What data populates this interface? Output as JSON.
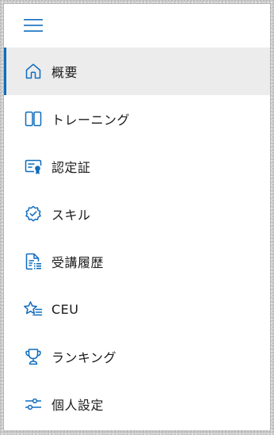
{
  "colors": {
    "accent": "#0f6cbd",
    "active_bg": "#ececec",
    "text": "#1b1b1b"
  },
  "menu_button": {
    "icon": "hamburger-menu-icon"
  },
  "nav": {
    "items": [
      {
        "id": "overview",
        "label": "概要",
        "icon": "home-icon",
        "active": true
      },
      {
        "id": "training",
        "label": "トレーニング",
        "icon": "book-icon",
        "active": false
      },
      {
        "id": "certifications",
        "label": "認定証",
        "icon": "certificate-icon",
        "active": false
      },
      {
        "id": "skills",
        "label": "スキル",
        "icon": "badge-check-icon",
        "active": false
      },
      {
        "id": "learning-history",
        "label": "受講履歴",
        "icon": "document-list-icon",
        "active": false
      },
      {
        "id": "ceu",
        "label": "CEU",
        "icon": "star-list-icon",
        "active": false
      },
      {
        "id": "ranking",
        "label": "ランキング",
        "icon": "trophy-icon",
        "active": false
      },
      {
        "id": "personal-settings",
        "label": "個人設定",
        "icon": "sliders-icon",
        "active": false
      }
    ]
  }
}
